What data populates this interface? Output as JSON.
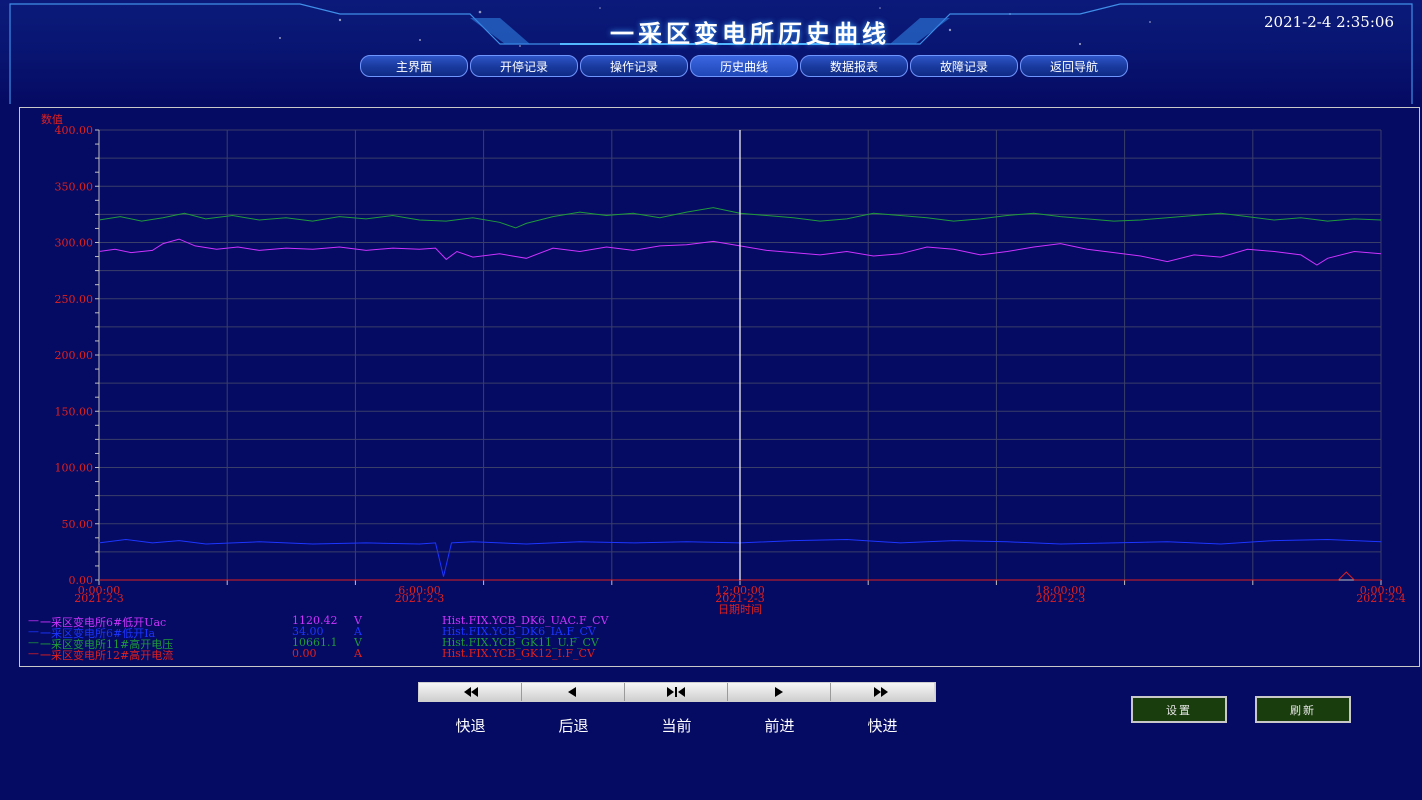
{
  "header": {
    "title": "一采区变电所历史曲线",
    "datetime": "2021-2-4 2:35:06"
  },
  "nav": {
    "items": [
      {
        "label": "主界面"
      },
      {
        "label": "开停记录"
      },
      {
        "label": "操作记录"
      },
      {
        "label": "历史曲线"
      },
      {
        "label": "数据报表"
      },
      {
        "label": "故障记录"
      },
      {
        "label": "返回导航"
      }
    ],
    "active_index": 3
  },
  "chart_data": {
    "type": "line",
    "ylabel": "数值",
    "xlabel": "日期时间",
    "ylim": [
      0,
      400
    ],
    "yticks": [
      "400.00",
      "350.00",
      "300.00",
      "250.00",
      "200.00",
      "150.00",
      "100.00",
      "50.00",
      "0.00"
    ],
    "xticks": [
      {
        "time": "0:00:00",
        "date": "2021-2-3"
      },
      {
        "time": "6:00:00",
        "date": "2021-2-3"
      },
      {
        "time": "12:00:00",
        "date": "2021-2-3"
      },
      {
        "time": "18:00:00",
        "date": "2021-2-3"
      },
      {
        "time": "0:00:00",
        "date": "2021-2-4"
      }
    ],
    "xlim_hours": [
      0,
      24
    ],
    "cursor_hour": 12,
    "grid": true,
    "series": [
      {
        "name": "一采区变电所6#低开Uac",
        "value": "1120.42",
        "unit": "V",
        "tag": "Hist.FIX.YCB_DK6_UAC.F_CV",
        "color": "#cc33ff",
        "points": [
          [
            0,
            292
          ],
          [
            0.3,
            294
          ],
          [
            0.6,
            291
          ],
          [
            1,
            293
          ],
          [
            1.2,
            299
          ],
          [
            1.5,
            303
          ],
          [
            1.8,
            297
          ],
          [
            2.2,
            294
          ],
          [
            2.6,
            296
          ],
          [
            3,
            293
          ],
          [
            3.5,
            295
          ],
          [
            4,
            294
          ],
          [
            4.5,
            296
          ],
          [
            5,
            293
          ],
          [
            5.5,
            295
          ],
          [
            6,
            294
          ],
          [
            6.3,
            295
          ],
          [
            6.5,
            285
          ],
          [
            6.7,
            292
          ],
          [
            7,
            287
          ],
          [
            7.5,
            290
          ],
          [
            8,
            286
          ],
          [
            8.5,
            295
          ],
          [
            9,
            292
          ],
          [
            9.5,
            296
          ],
          [
            10,
            293
          ],
          [
            10.5,
            297
          ],
          [
            11,
            298
          ],
          [
            11.5,
            301
          ],
          [
            12,
            297
          ],
          [
            12.5,
            293
          ],
          [
            13,
            291
          ],
          [
            13.5,
            289
          ],
          [
            14,
            292
          ],
          [
            14.5,
            288
          ],
          [
            15,
            290
          ],
          [
            15.5,
            296
          ],
          [
            16,
            294
          ],
          [
            16.5,
            289
          ],
          [
            17,
            292
          ],
          [
            17.5,
            296
          ],
          [
            18,
            299
          ],
          [
            18.5,
            294
          ],
          [
            19,
            291
          ],
          [
            19.5,
            288
          ],
          [
            20,
            283
          ],
          [
            20.5,
            289
          ],
          [
            21,
            287
          ],
          [
            21.5,
            294
          ],
          [
            22,
            292
          ],
          [
            22.5,
            289
          ],
          [
            22.8,
            280
          ],
          [
            23,
            286
          ],
          [
            23.5,
            292
          ],
          [
            24,
            290
          ]
        ]
      },
      {
        "name": "一采区变电所6#低开Ia",
        "value": "34.00",
        "unit": "A",
        "tag": "Hist.FIX.YCB_DK6_IA.F_CV",
        "color": "#1c36ff",
        "points": [
          [
            0,
            33
          ],
          [
            0.5,
            36
          ],
          [
            1,
            33
          ],
          [
            1.5,
            35
          ],
          [
            2,
            32
          ],
          [
            3,
            34
          ],
          [
            4,
            32
          ],
          [
            5,
            33
          ],
          [
            6,
            32
          ],
          [
            6.3,
            33
          ],
          [
            6.45,
            3
          ],
          [
            6.6,
            33
          ],
          [
            7,
            34
          ],
          [
            8,
            32
          ],
          [
            9,
            34
          ],
          [
            10,
            33
          ],
          [
            11,
            34
          ],
          [
            12,
            33
          ],
          [
            13,
            35
          ],
          [
            14,
            36
          ],
          [
            15,
            33
          ],
          [
            16,
            35
          ],
          [
            17,
            34
          ],
          [
            18,
            32
          ],
          [
            19,
            33
          ],
          [
            20,
            34
          ],
          [
            21,
            32
          ],
          [
            22,
            35
          ],
          [
            23,
            36
          ],
          [
            24,
            34
          ]
        ]
      },
      {
        "name": "一采区变电所11#高开电压",
        "value": "10661.1",
        "unit": "V",
        "tag": "Hist.FIX.YCB_GK11_U.F_CV",
        "color": "#1f9a3c",
        "points": [
          [
            0,
            320
          ],
          [
            0.4,
            323
          ],
          [
            0.8,
            319
          ],
          [
            1.2,
            322
          ],
          [
            1.6,
            326
          ],
          [
            2,
            321
          ],
          [
            2.5,
            324
          ],
          [
            3,
            320
          ],
          [
            3.5,
            322
          ],
          [
            4,
            319
          ],
          [
            4.5,
            323
          ],
          [
            5,
            321
          ],
          [
            5.5,
            324
          ],
          [
            6,
            320
          ],
          [
            6.5,
            319
          ],
          [
            7,
            322
          ],
          [
            7.5,
            318
          ],
          [
            7.8,
            313
          ],
          [
            8,
            317
          ],
          [
            8.5,
            323
          ],
          [
            9,
            327
          ],
          [
            9.5,
            324
          ],
          [
            10,
            326
          ],
          [
            10.5,
            322
          ],
          [
            11,
            327
          ],
          [
            11.5,
            331
          ],
          [
            12,
            326
          ],
          [
            12.5,
            324
          ],
          [
            13,
            322
          ],
          [
            13.5,
            319
          ],
          [
            14,
            321
          ],
          [
            14.5,
            326
          ],
          [
            15,
            324
          ],
          [
            15.5,
            322
          ],
          [
            16,
            319
          ],
          [
            16.5,
            321
          ],
          [
            17,
            324
          ],
          [
            17.5,
            326
          ],
          [
            18,
            323
          ],
          [
            18.5,
            321
          ],
          [
            19,
            319
          ],
          [
            19.5,
            320
          ],
          [
            20,
            322
          ],
          [
            20.5,
            324
          ],
          [
            21,
            326
          ],
          [
            21.5,
            323
          ],
          [
            22,
            320
          ],
          [
            22.5,
            322
          ],
          [
            23,
            319
          ],
          [
            23.5,
            321
          ],
          [
            24,
            320
          ]
        ]
      },
      {
        "name": "一采区变电所12#高开电流",
        "value": "0.00",
        "unit": "A",
        "tag": "Hist.FIX.YCB_GK12_I.F_CV",
        "color": "#e02020",
        "points": [
          [
            0,
            0
          ],
          [
            23.2,
            0
          ],
          [
            23.35,
            7
          ],
          [
            23.5,
            0
          ],
          [
            24,
            0
          ]
        ]
      }
    ]
  },
  "controls": {
    "buttons": [
      {
        "label": "快退",
        "icon": "fast-rewind-icon"
      },
      {
        "label": "后退",
        "icon": "step-back-icon"
      },
      {
        "label": "当前",
        "icon": "current-icon"
      },
      {
        "label": "前进",
        "icon": "step-forward-icon"
      },
      {
        "label": "快进",
        "icon": "fast-forward-icon"
      }
    ]
  },
  "actions": {
    "settings_label": "设置",
    "refresh_label": "刷新"
  }
}
